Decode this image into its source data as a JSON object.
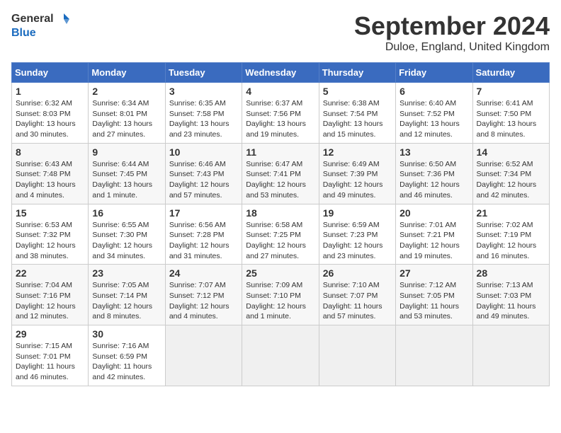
{
  "header": {
    "logo_general": "General",
    "logo_blue": "Blue",
    "month_title": "September 2024",
    "location": "Duloe, England, United Kingdom"
  },
  "days_of_week": [
    "Sunday",
    "Monday",
    "Tuesday",
    "Wednesday",
    "Thursday",
    "Friday",
    "Saturday"
  ],
  "weeks": [
    [
      {
        "day": "1",
        "info": "Sunrise: 6:32 AM\nSunset: 8:03 PM\nDaylight: 13 hours\nand 30 minutes."
      },
      {
        "day": "2",
        "info": "Sunrise: 6:34 AM\nSunset: 8:01 PM\nDaylight: 13 hours\nand 27 minutes."
      },
      {
        "day": "3",
        "info": "Sunrise: 6:35 AM\nSunset: 7:58 PM\nDaylight: 13 hours\nand 23 minutes."
      },
      {
        "day": "4",
        "info": "Sunrise: 6:37 AM\nSunset: 7:56 PM\nDaylight: 13 hours\nand 19 minutes."
      },
      {
        "day": "5",
        "info": "Sunrise: 6:38 AM\nSunset: 7:54 PM\nDaylight: 13 hours\nand 15 minutes."
      },
      {
        "day": "6",
        "info": "Sunrise: 6:40 AM\nSunset: 7:52 PM\nDaylight: 13 hours\nand 12 minutes."
      },
      {
        "day": "7",
        "info": "Sunrise: 6:41 AM\nSunset: 7:50 PM\nDaylight: 13 hours\nand 8 minutes."
      }
    ],
    [
      {
        "day": "8",
        "info": "Sunrise: 6:43 AM\nSunset: 7:48 PM\nDaylight: 13 hours\nand 4 minutes."
      },
      {
        "day": "9",
        "info": "Sunrise: 6:44 AM\nSunset: 7:45 PM\nDaylight: 13 hours\nand 1 minute."
      },
      {
        "day": "10",
        "info": "Sunrise: 6:46 AM\nSunset: 7:43 PM\nDaylight: 12 hours\nand 57 minutes."
      },
      {
        "day": "11",
        "info": "Sunrise: 6:47 AM\nSunset: 7:41 PM\nDaylight: 12 hours\nand 53 minutes."
      },
      {
        "day": "12",
        "info": "Sunrise: 6:49 AM\nSunset: 7:39 PM\nDaylight: 12 hours\nand 49 minutes."
      },
      {
        "day": "13",
        "info": "Sunrise: 6:50 AM\nSunset: 7:36 PM\nDaylight: 12 hours\nand 46 minutes."
      },
      {
        "day": "14",
        "info": "Sunrise: 6:52 AM\nSunset: 7:34 PM\nDaylight: 12 hours\nand 42 minutes."
      }
    ],
    [
      {
        "day": "15",
        "info": "Sunrise: 6:53 AM\nSunset: 7:32 PM\nDaylight: 12 hours\nand 38 minutes."
      },
      {
        "day": "16",
        "info": "Sunrise: 6:55 AM\nSunset: 7:30 PM\nDaylight: 12 hours\nand 34 minutes."
      },
      {
        "day": "17",
        "info": "Sunrise: 6:56 AM\nSunset: 7:28 PM\nDaylight: 12 hours\nand 31 minutes."
      },
      {
        "day": "18",
        "info": "Sunrise: 6:58 AM\nSunset: 7:25 PM\nDaylight: 12 hours\nand 27 minutes."
      },
      {
        "day": "19",
        "info": "Sunrise: 6:59 AM\nSunset: 7:23 PM\nDaylight: 12 hours\nand 23 minutes."
      },
      {
        "day": "20",
        "info": "Sunrise: 7:01 AM\nSunset: 7:21 PM\nDaylight: 12 hours\nand 19 minutes."
      },
      {
        "day": "21",
        "info": "Sunrise: 7:02 AM\nSunset: 7:19 PM\nDaylight: 12 hours\nand 16 minutes."
      }
    ],
    [
      {
        "day": "22",
        "info": "Sunrise: 7:04 AM\nSunset: 7:16 PM\nDaylight: 12 hours\nand 12 minutes."
      },
      {
        "day": "23",
        "info": "Sunrise: 7:05 AM\nSunset: 7:14 PM\nDaylight: 12 hours\nand 8 minutes."
      },
      {
        "day": "24",
        "info": "Sunrise: 7:07 AM\nSunset: 7:12 PM\nDaylight: 12 hours\nand 4 minutes."
      },
      {
        "day": "25",
        "info": "Sunrise: 7:09 AM\nSunset: 7:10 PM\nDaylight: 12 hours\nand 1 minute."
      },
      {
        "day": "26",
        "info": "Sunrise: 7:10 AM\nSunset: 7:07 PM\nDaylight: 11 hours\nand 57 minutes."
      },
      {
        "day": "27",
        "info": "Sunrise: 7:12 AM\nSunset: 7:05 PM\nDaylight: 11 hours\nand 53 minutes."
      },
      {
        "day": "28",
        "info": "Sunrise: 7:13 AM\nSunset: 7:03 PM\nDaylight: 11 hours\nand 49 minutes."
      }
    ],
    [
      {
        "day": "29",
        "info": "Sunrise: 7:15 AM\nSunset: 7:01 PM\nDaylight: 11 hours\nand 46 minutes."
      },
      {
        "day": "30",
        "info": "Sunrise: 7:16 AM\nSunset: 6:59 PM\nDaylight: 11 hours\nand 42 minutes."
      },
      {
        "day": "",
        "info": ""
      },
      {
        "day": "",
        "info": ""
      },
      {
        "day": "",
        "info": ""
      },
      {
        "day": "",
        "info": ""
      },
      {
        "day": "",
        "info": ""
      }
    ]
  ]
}
